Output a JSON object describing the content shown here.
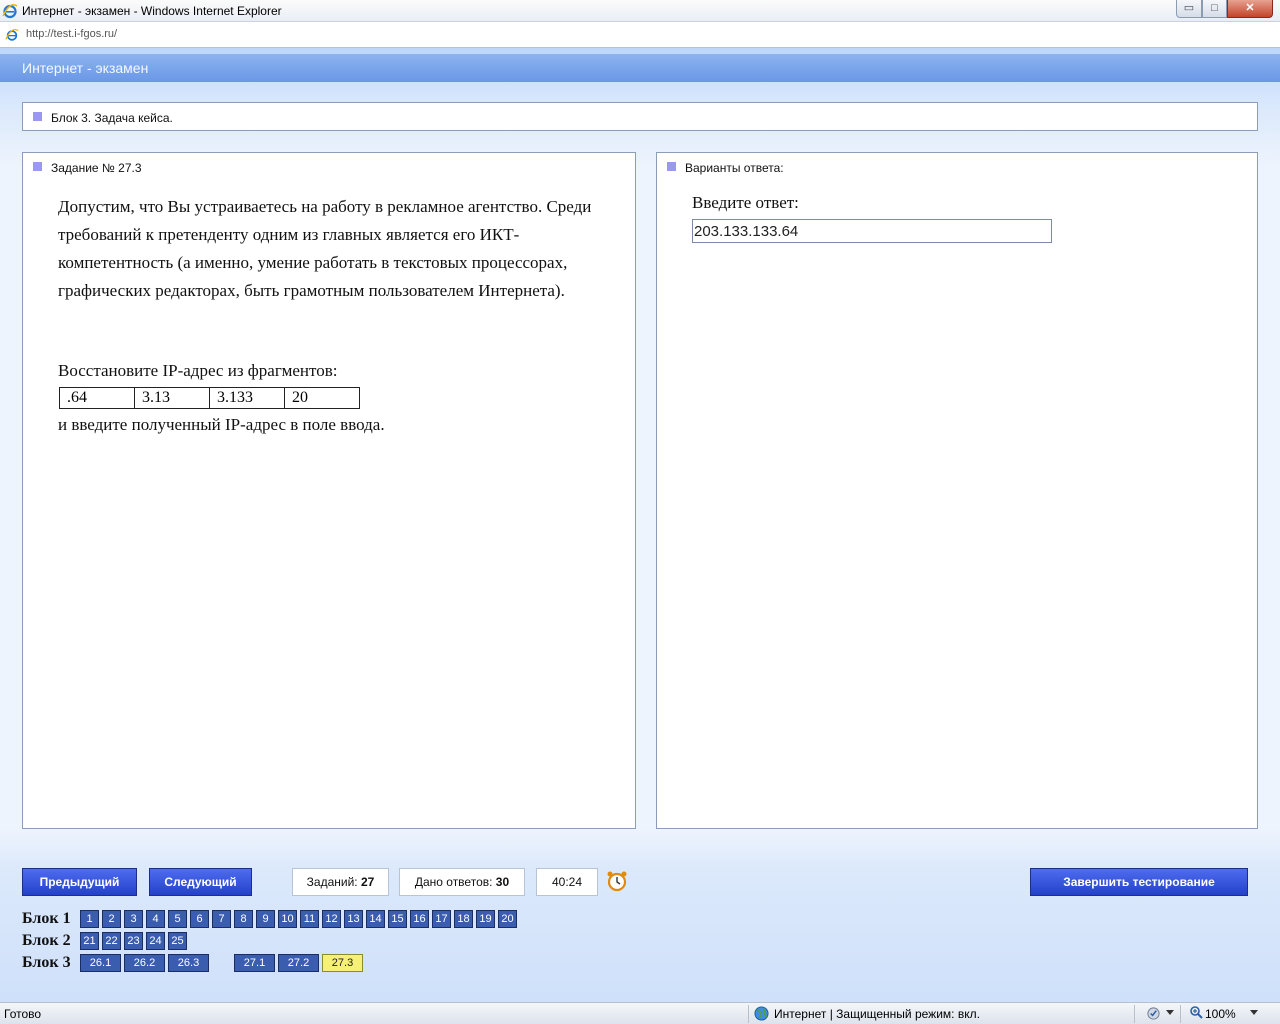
{
  "window": {
    "title": "Интернет - экзамен - Windows Internet Explorer",
    "url": "http://test.i-fgos.ru/",
    "controls": {
      "minimize": "▭",
      "maximize": "□",
      "close": "✕"
    }
  },
  "app": {
    "title": "Интернет - экзамен"
  },
  "block_header": "Блок 3. Задача кейса.",
  "question": {
    "label": "Задание № 27.3",
    "text": "Допустим, что Вы устраиваетесь на работу в рекламное агентство. Среди требований к претенденту одним из главных является его ИКТ-компетентность (а именно, умение работать в текстовых процессорах, графических редакторах, быть грамотным пользователем Интернета).",
    "restore_label": "Восстановите IP-адрес из фрагментов:",
    "fragments": [
      ".64",
      "3.13",
      "3.133",
      "20"
    ],
    "after_label": "и введите полученный IP-адрес в поле ввода."
  },
  "answer": {
    "label": "Варианты ответа:",
    "prompt": "Введите ответ:",
    "value": "203.133.133.64"
  },
  "nav": {
    "prev": "Предыдущий",
    "next": "Следующий",
    "finish": "Завершить тестирование",
    "tasks_label": "Заданий:",
    "tasks_value": "27",
    "answers_label": "Дано ответов:",
    "answers_value": "30",
    "timer": "40:24"
  },
  "blocks": [
    {
      "label": "Блок 1",
      "items": [
        "1",
        "2",
        "3",
        "4",
        "5",
        "6",
        "7",
        "8",
        "9",
        "10",
        "11",
        "12",
        "13",
        "14",
        "15",
        "16",
        "17",
        "18",
        "19",
        "20"
      ]
    },
    {
      "label": "Блок 2",
      "items": [
        "21",
        "22",
        "23",
        "24",
        "25"
      ]
    },
    {
      "label": "Блок 3",
      "items": [
        "26.1",
        "26.2",
        "26.3",
        "27.1",
        "27.2",
        "27.3"
      ],
      "current": "27.3"
    }
  ],
  "statusbar": {
    "ready": "Готово",
    "zone": "Интернет | Защищенный режим: вкл.",
    "zoom": "100%"
  },
  "colors": {
    "button": "#2f4fd8",
    "question_number": "#3a5db0",
    "current_question": "#f6f078",
    "bullet": "#9a98f0",
    "header_bar": "#7aa5ec"
  }
}
